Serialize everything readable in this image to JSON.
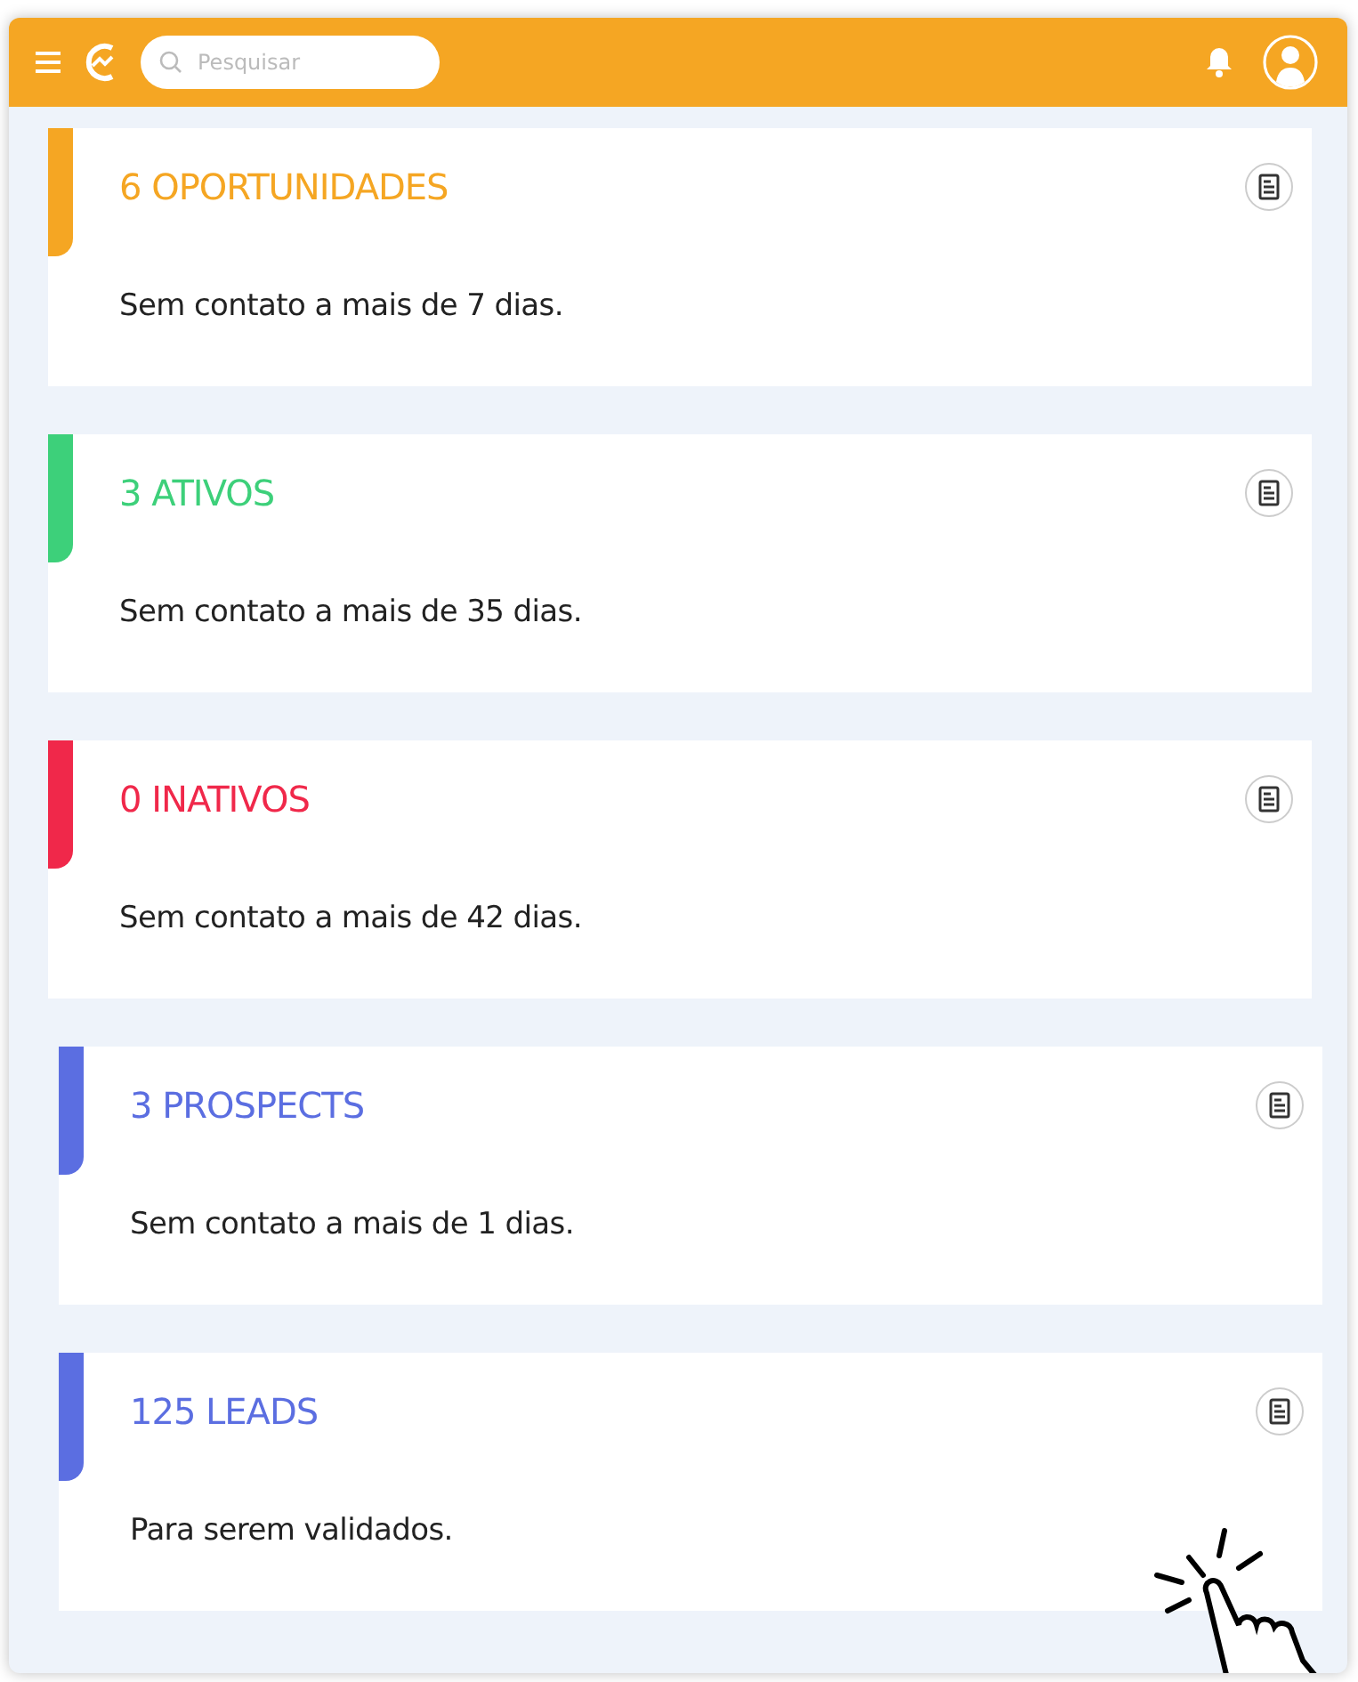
{
  "header": {
    "search": {
      "placeholder": "Pesquisar"
    }
  },
  "cards": [
    {
      "title": "6 OPORTUNIDADES",
      "description": "Sem contato a mais de 7 dias.",
      "color": "#f5a623"
    },
    {
      "title": "3 ATIVOS",
      "description": "Sem contato a mais de 35 dias.",
      "color": "#3dd07a"
    },
    {
      "title": "0 INATIVOS",
      "description": "Sem contato a mais de 42 dias.",
      "color": "#f0284a"
    },
    {
      "title": "3 PROSPECTS",
      "description": "Sem contato a mais de 1 dias.",
      "color": "#5b6ee1"
    },
    {
      "title": "125 LEADS",
      "description": "Para serem validados.",
      "color": "#5b6ee1"
    }
  ]
}
